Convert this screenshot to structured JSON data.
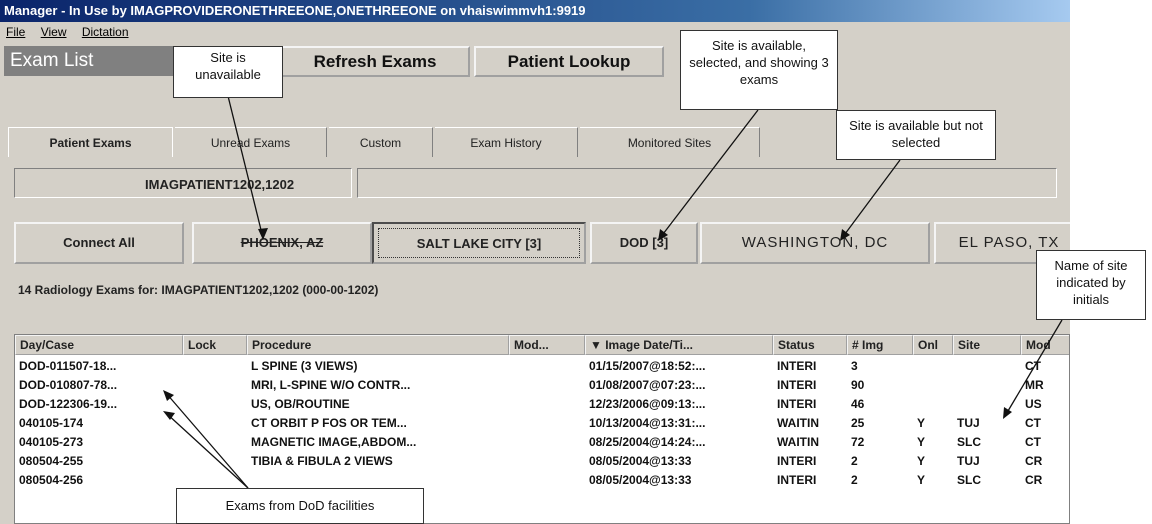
{
  "window": {
    "title": "Manager - In Use by IMAGPROVIDERONETHREEONE,ONETHREEONE on vhaiswimmvh1:9919"
  },
  "menu": [
    "File",
    "View",
    "Dictation"
  ],
  "header": {
    "exam_list": "Exam List",
    "refresh_button": "Refresh Exams",
    "patient_lookup_button": "Patient Lookup"
  },
  "tabs": [
    {
      "label": "Patient Exams",
      "active": true
    },
    {
      "label": "Unread Exams",
      "active": false
    },
    {
      "label": "Custom",
      "active": false
    },
    {
      "label": "Exam History",
      "active": false
    },
    {
      "label": "Monitored Sites",
      "active": false
    }
  ],
  "patient": {
    "name": "IMAGPATIENT1202,1202"
  },
  "sites": {
    "connect_all": "Connect All",
    "items": [
      {
        "label": "PHOENIX, AZ",
        "state": "unavailable"
      },
      {
        "label": "SALT LAKE CITY [3]",
        "state": "selected"
      },
      {
        "label": "DOD [3]",
        "state": "available"
      },
      {
        "label": "WASHINGTON, DC",
        "state": "available"
      },
      {
        "label": "EL PASO, TX",
        "state": "available"
      }
    ]
  },
  "exam_count_text": "14 Radiology Exams for: IMAGPATIENT1202,1202 (000-00-1202)",
  "grid": {
    "columns": [
      "Day/Case",
      "Lock",
      "Procedure",
      "Mod...",
      "▼  Image Date/Ti...",
      "Status",
      "# Img",
      "Onl",
      "Site",
      "Mod"
    ],
    "rows": [
      [
        "DOD-011507-18...",
        "",
        "L SPINE (3 VIEWS)",
        "",
        "01/15/2007@18:52:...",
        "INTERI",
        "3",
        "",
        "",
        "CT"
      ],
      [
        "DOD-010807-78...",
        "",
        "MRI, L-SPINE W/O CONTR...",
        "",
        "01/08/2007@07:23:...",
        "INTERI",
        "90",
        "",
        "",
        "MR"
      ],
      [
        "DOD-122306-19...",
        "",
        "US, OB/ROUTINE",
        "",
        "12/23/2006@09:13:...",
        "INTERI",
        "46",
        "",
        "",
        "US"
      ],
      [
        "040105-174",
        "",
        "CT ORBIT P FOS OR TEM...",
        "",
        "10/13/2004@13:31:...",
        "WAITIN",
        "25",
        "Y",
        "TUJ",
        "CT"
      ],
      [
        "040105-273",
        "",
        "MAGNETIC IMAGE,ABDOM...",
        "",
        "08/25/2004@14:24:...",
        "WAITIN",
        "72",
        "Y",
        "SLC",
        "CT"
      ],
      [
        "080504-255",
        "",
        "TIBIA & FIBULA 2 VIEWS",
        "",
        "08/05/2004@13:33",
        "INTERI",
        "2",
        "Y",
        "TUJ",
        "CR"
      ],
      [
        "080504-256",
        "",
        "",
        "",
        "08/05/2004@13:33",
        "INTERI",
        "2",
        "Y",
        "SLC",
        "CR"
      ]
    ]
  },
  "callouts": {
    "unavailable": "Site is unavailable",
    "selected": "Site is available, selected, and showing 3 exams",
    "not_selected": "Site is available but not selected",
    "initials": "Name of site indicated by initials",
    "dod": "Exams from DoD facilities"
  }
}
